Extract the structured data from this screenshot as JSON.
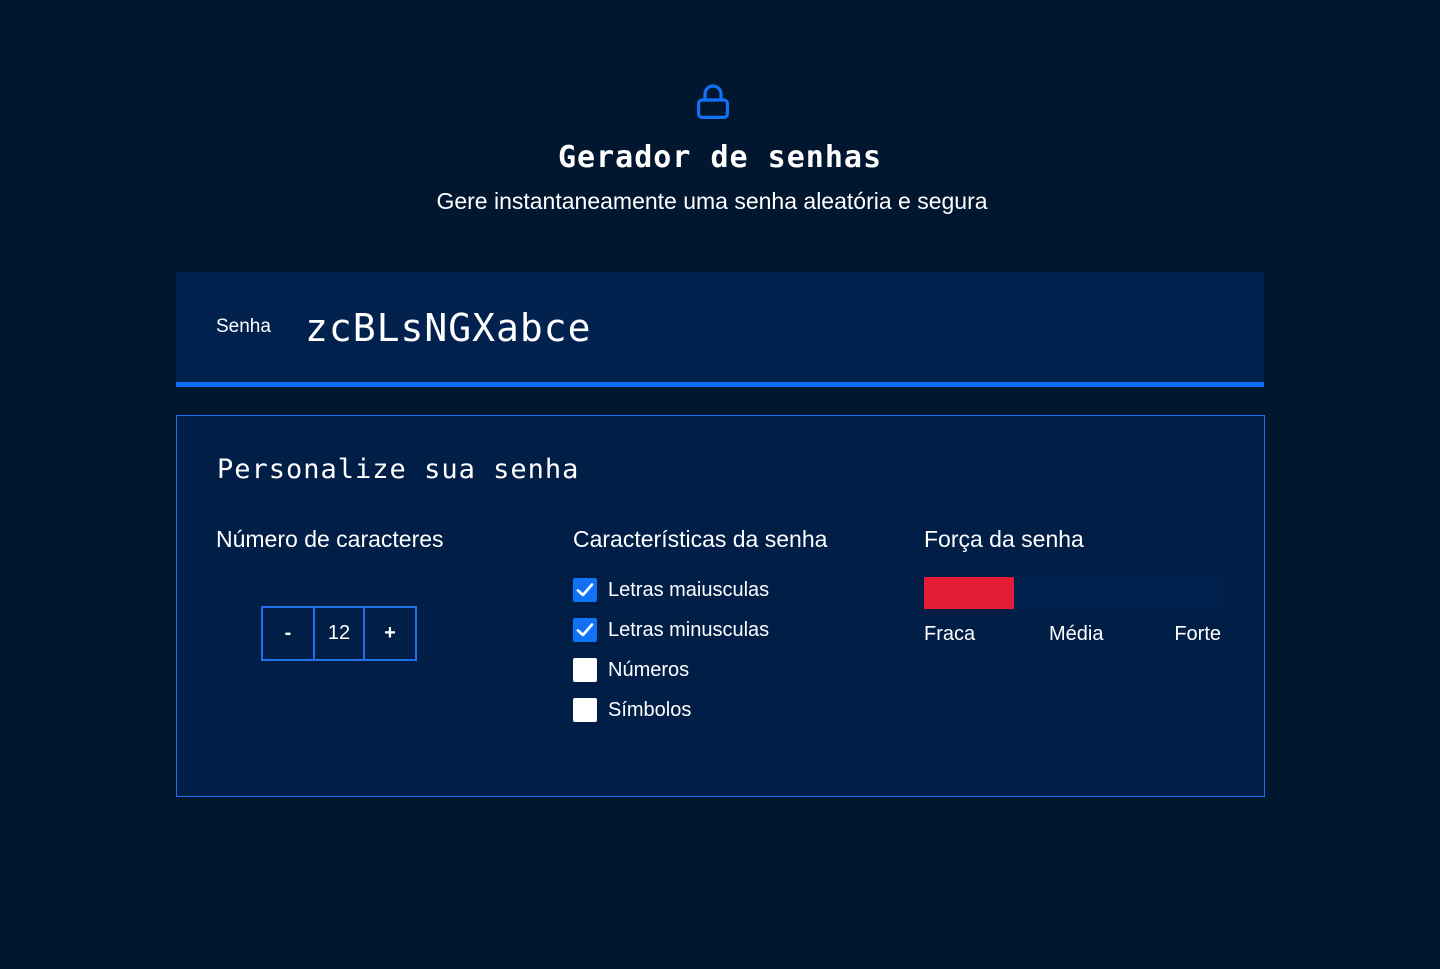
{
  "header": {
    "icon": "lock-icon",
    "title": "Gerador de senhas",
    "subtitle": "Gere instantaneamente uma senha aleatória e segura"
  },
  "password": {
    "label": "Senha",
    "value": "zcBLsNGXabce"
  },
  "customize": {
    "title": "Personalize sua senha",
    "length": {
      "title": "Número de caracteres",
      "decrement_label": "-",
      "value": "12",
      "increment_label": "+"
    },
    "features": {
      "title": "Características da senha",
      "options": [
        {
          "label": "Letras maiusculas",
          "checked": true
        },
        {
          "label": "Letras minusculas",
          "checked": true
        },
        {
          "label": "Números",
          "checked": false
        },
        {
          "label": "Símbolos",
          "checked": false
        }
      ]
    },
    "strength": {
      "title": "Força da senha",
      "level_fraction": 0.3,
      "labels": [
        "Fraca",
        "Média",
        "Forte"
      ]
    }
  },
  "colors": {
    "background": "#011730",
    "panel": "#011e47",
    "accent": "#1f6fe8",
    "weak": "#e31b35"
  }
}
